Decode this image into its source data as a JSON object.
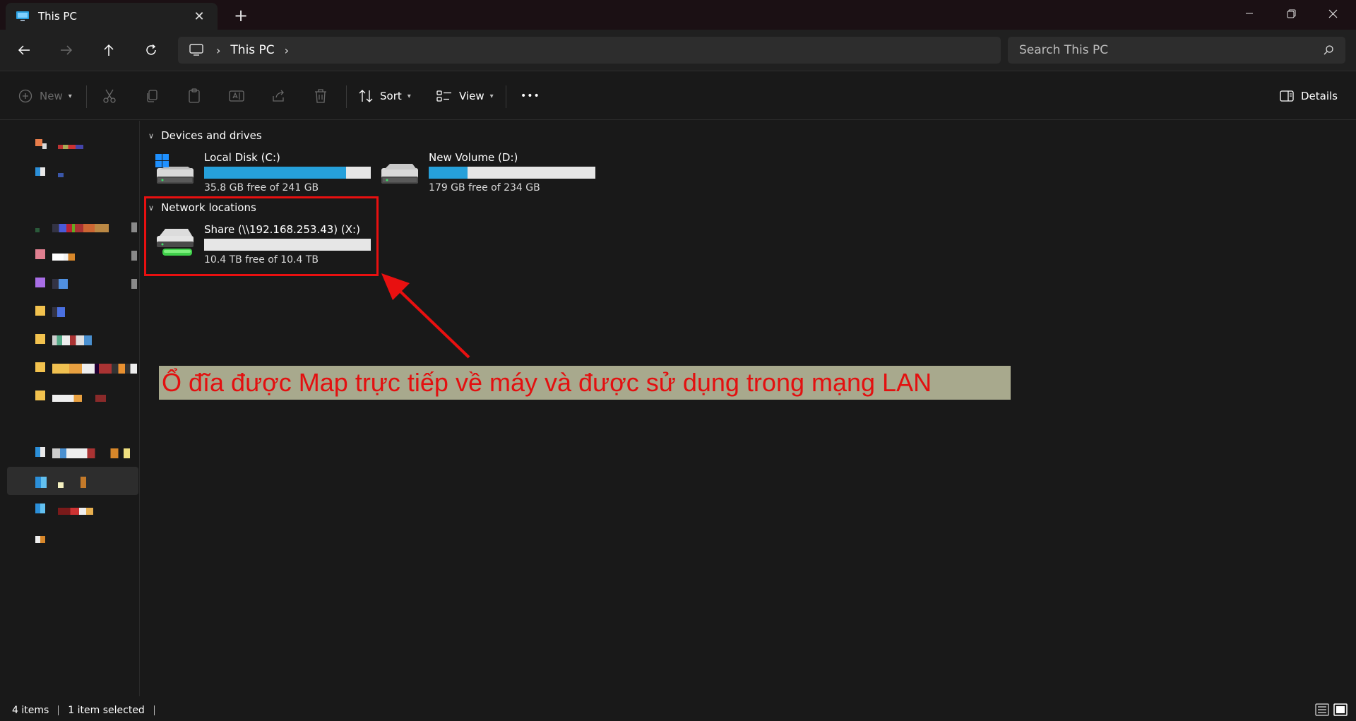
{
  "window": {
    "tab_title": "This PC",
    "tab_close": "✕",
    "new_tab": "+",
    "minimize": "—",
    "maximize": "❐",
    "close": "✕"
  },
  "nav": {
    "breadcrumb": [
      "This PC"
    ],
    "search_placeholder": "Search This PC"
  },
  "toolbar": {
    "new_label": "New",
    "sort_label": "Sort",
    "view_label": "View",
    "more_label": "•••",
    "details_label": "Details"
  },
  "main": {
    "devices_header": "Devices and drives",
    "network_header": "Network locations",
    "drives": [
      {
        "name": "Local Disk (C:)",
        "free_text": "35.8 GB free of 241 GB",
        "used_fraction": 0.85
      },
      {
        "name": "New Volume (D:)",
        "free_text": "179 GB free of 234 GB",
        "used_fraction": 0.235
      }
    ],
    "network_drives": [
      {
        "name": "Share (\\\\192.168.253.43) (X:)",
        "free_text": "10.4 TB free of 10.4 TB",
        "used_fraction": 0.0
      }
    ]
  },
  "annotation": {
    "text": "Ổ đĩa được Map trực tiếp về máy và được sử dụng trong mạng LAN",
    "color": "#e31010"
  },
  "status": {
    "items_count": "4 items",
    "selected": "1 item selected"
  },
  "colors": {
    "accent": "#26a0da",
    "highlight": "#e81010"
  }
}
